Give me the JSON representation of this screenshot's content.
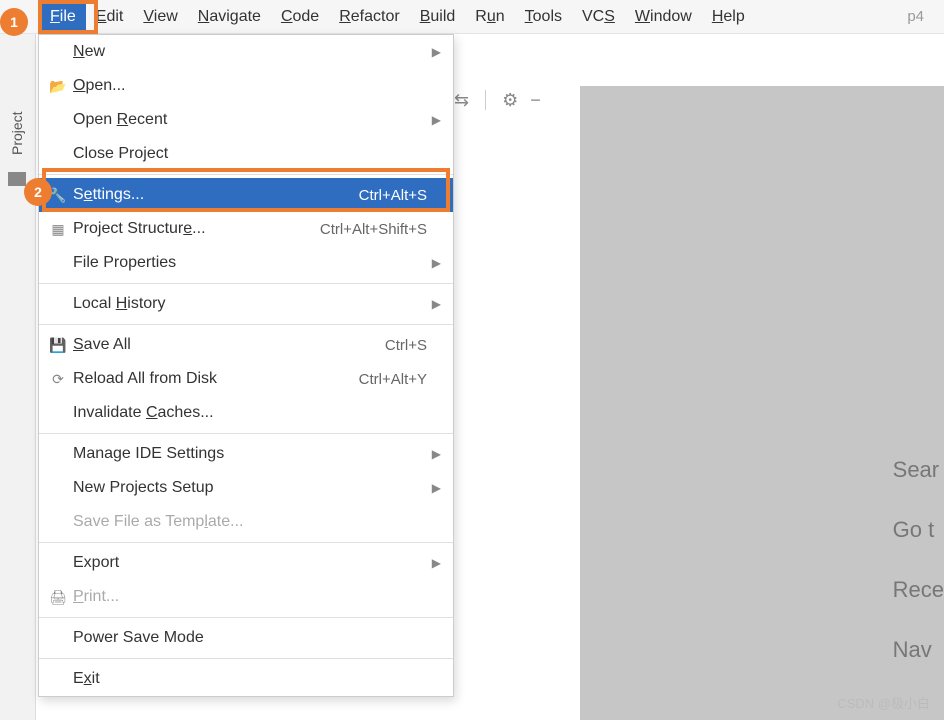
{
  "menubar": {
    "items": [
      {
        "pre": "",
        "u": "F",
        "post": "ile",
        "name": "file"
      },
      {
        "pre": "",
        "u": "E",
        "post": "dit",
        "name": "edit"
      },
      {
        "pre": "",
        "u": "V",
        "post": "iew",
        "name": "view"
      },
      {
        "pre": "",
        "u": "N",
        "post": "avigate",
        "name": "navigate"
      },
      {
        "pre": "",
        "u": "C",
        "post": "ode",
        "name": "code"
      },
      {
        "pre": "",
        "u": "R",
        "post": "efactor",
        "name": "refactor"
      },
      {
        "pre": "",
        "u": "B",
        "post": "uild",
        "name": "build"
      },
      {
        "pre": "R",
        "u": "u",
        "post": "n",
        "name": "run"
      },
      {
        "pre": "",
        "u": "T",
        "post": "ools",
        "name": "tools"
      },
      {
        "pre": "VC",
        "u": "S",
        "post": "",
        "name": "vcs"
      },
      {
        "pre": "",
        "u": "W",
        "post": "indow",
        "name": "window"
      },
      {
        "pre": "",
        "u": "H",
        "post": "elp",
        "name": "help"
      }
    ],
    "project_label": "p4"
  },
  "sidebar": {
    "project_tab": "Project"
  },
  "callouts": {
    "one": "1",
    "two": "2"
  },
  "dropdown": [
    {
      "type": "item",
      "icon": "",
      "pre": "",
      "u": "N",
      "post": "ew",
      "shortcut": "",
      "arrow": true,
      "name": "new"
    },
    {
      "type": "item",
      "icon": "📂",
      "pre": "",
      "u": "O",
      "post": "pen...",
      "shortcut": "",
      "arrow": false,
      "name": "open"
    },
    {
      "type": "item",
      "icon": "",
      "pre": "Open ",
      "u": "R",
      "post": "ecent",
      "shortcut": "",
      "arrow": true,
      "name": "open-recent"
    },
    {
      "type": "item",
      "icon": "",
      "pre": "Close Pro",
      "u": "j",
      "post": "ect",
      "shortcut": "",
      "arrow": false,
      "name": "close-project"
    },
    {
      "type": "sep"
    },
    {
      "type": "item",
      "icon": "🔧",
      "pre": "S",
      "u": "e",
      "post": "ttings...",
      "shortcut": "Ctrl+Alt+S",
      "arrow": false,
      "selected": true,
      "name": "settings"
    },
    {
      "type": "item",
      "icon": "▦",
      "pre": "Project Structur",
      "u": "e",
      "post": "...",
      "shortcut": "Ctrl+Alt+Shift+S",
      "arrow": false,
      "name": "project-structure"
    },
    {
      "type": "item",
      "icon": "",
      "pre": "File Properties",
      "u": "",
      "post": "",
      "shortcut": "",
      "arrow": true,
      "name": "file-properties"
    },
    {
      "type": "sep"
    },
    {
      "type": "item",
      "icon": "",
      "pre": "Local ",
      "u": "H",
      "post": "istory",
      "shortcut": "",
      "arrow": true,
      "name": "local-history"
    },
    {
      "type": "sep"
    },
    {
      "type": "item",
      "icon": "💾",
      "pre": "",
      "u": "S",
      "post": "ave All",
      "shortcut": "Ctrl+S",
      "arrow": false,
      "name": "save-all"
    },
    {
      "type": "item",
      "icon": "⟳",
      "pre": "Reload All from Disk",
      "u": "",
      "post": "",
      "shortcut": "Ctrl+Alt+Y",
      "arrow": false,
      "name": "reload-from-disk"
    },
    {
      "type": "item",
      "icon": "",
      "pre": "Invalidate ",
      "u": "C",
      "post": "aches...",
      "shortcut": "",
      "arrow": false,
      "name": "invalidate-caches"
    },
    {
      "type": "sep"
    },
    {
      "type": "item",
      "icon": "",
      "pre": "Manage IDE Settings",
      "u": "",
      "post": "",
      "shortcut": "",
      "arrow": true,
      "name": "manage-ide-settings"
    },
    {
      "type": "item",
      "icon": "",
      "pre": "New Projects Setup",
      "u": "",
      "post": "",
      "shortcut": "",
      "arrow": true,
      "name": "new-projects-setup"
    },
    {
      "type": "item",
      "icon": "",
      "pre": "Save File as Temp",
      "u": "l",
      "post": "ate...",
      "shortcut": "",
      "arrow": false,
      "disabled": true,
      "name": "save-file-as-template"
    },
    {
      "type": "sep"
    },
    {
      "type": "item",
      "icon": "",
      "pre": "Export",
      "u": "",
      "post": "",
      "shortcut": "",
      "arrow": true,
      "name": "export"
    },
    {
      "type": "item",
      "icon": "🖨",
      "pre": "",
      "u": "P",
      "post": "rint...",
      "shortcut": "",
      "arrow": false,
      "disabled": true,
      "name": "print"
    },
    {
      "type": "sep"
    },
    {
      "type": "item",
      "icon": "",
      "pre": "Power Save Mode",
      "u": "",
      "post": "",
      "shortcut": "",
      "arrow": false,
      "name": "power-save-mode"
    },
    {
      "type": "sep"
    },
    {
      "type": "item",
      "icon": "",
      "pre": "E",
      "u": "x",
      "post": "it",
      "shortcut": "",
      "arrow": false,
      "name": "exit"
    }
  ],
  "right_hints": [
    "Sear",
    "Go t",
    "Rece",
    "Nav"
  ],
  "watermark": "CSDN @极小白"
}
